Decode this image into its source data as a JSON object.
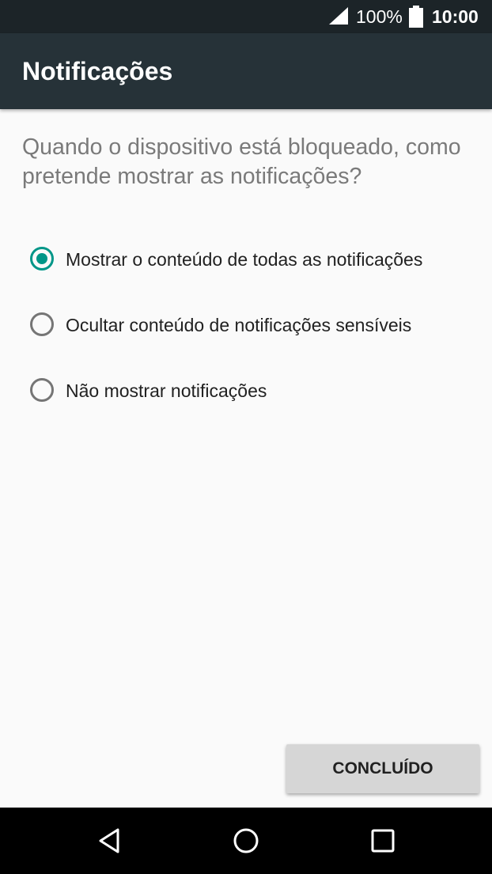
{
  "status_bar": {
    "battery_percent": "100%",
    "time": "10:00",
    "icons": [
      "cell-signal-icon",
      "battery-full-icon"
    ]
  },
  "app_bar": {
    "title": "Notificações"
  },
  "question": "Quando o dispositivo está bloqueado, como pretende mostrar as notificações?",
  "options": [
    {
      "label": "Mostrar o conteúdo de todas as notificações",
      "selected": true
    },
    {
      "label": "Ocultar conteúdo de notificações sensíveis",
      "selected": false
    },
    {
      "label": "Não mostrar notificações",
      "selected": false
    }
  ],
  "done_button": "CONCLUÍDO",
  "nav_bar": {
    "icons": [
      "back-icon",
      "home-icon",
      "recents-icon"
    ]
  },
  "colors": {
    "accent": "#009688",
    "app_bar": "#263238",
    "status_bar": "#1c2428",
    "background": "#fafafa"
  }
}
